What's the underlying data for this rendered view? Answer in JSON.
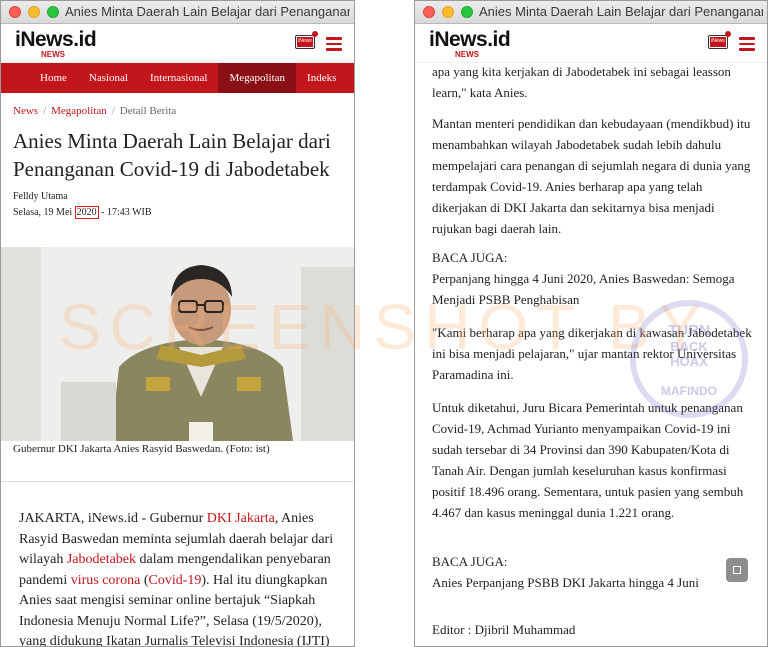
{
  "left": {
    "window_title": "Anies Minta Daerah Lain Belajar dari Penanganan Covid-19 di Jabodetabek",
    "logo_main": "iNews.id",
    "logo_sub": "NEWS",
    "tv_label": "iNews",
    "nav": [
      "Home",
      "Nasional",
      "Internasional",
      "Megapolitan",
      "Indeks"
    ],
    "breadcrumb": [
      "News",
      "Megapolitan",
      "Detail Berita"
    ],
    "headline": "Anies Minta Daerah Lain Belajar dari Penanganan Covid-19 di Jabodetabek",
    "author": "Felldy Utama",
    "date_prefix": "Selasa, 19 Mei ",
    "date_year": "2020",
    "date_suffix": " - 17:43 WIB",
    "caption": "Gubernur DKI Jakarta Anies Rasyid Baswedan. (Foto: ist)",
    "body": {
      "t1": "JAKARTA, iNews.id - Gubernur ",
      "l1": "DKI Jakarta",
      "t2": ", Anies Rasyid Baswedan meminta sejumlah daerah belajar dari wilayah ",
      "l2": "Jabodetabek",
      "t3": " dalam mengendalikan penyebaran pandemi ",
      "l3": "virus corona",
      "t4": " (",
      "l4": "Covid-19",
      "t5": "). Hal itu diungkapkan Anies saat mengisi seminar online bertajuk “Siapkah Indonesia Menuju Normal Life?”, Selasa (19/5/2020), yang didukung Ikatan Jurnalis Televisi Indonesia (IJTI)"
    }
  },
  "right": {
    "window_title": "Anies Minta Daerah Lain Belajar dari Penanganan Covid-19 di Jabodetabek",
    "logo_main": "iNews.id",
    "logo_sub": "NEWS",
    "tv_label": "iNews",
    "p1": "apa yang kita kerjakan di Jabodetabek ini sebagai leasson learn,\" kata Anies.",
    "p2": "Mantan menteri pendidikan dan kebudayaan (mendikbud) itu menambahkan wilayah Jabodetabek sudah lebih dahulu mempelajari cara penangan di sejumlah negara di dunia yang terdampak Covid-19. Anies berharap apa yang telah dikerjakan di DKI Jakarta dan sekitarnya bisa menjadi rujukan bagi daerah lain.",
    "baca1_label": "BACA JUGA:",
    "baca1_link": "Perpanjang hingga 4 Juni 2020, Anies Baswedan: Semoga Menjadi PSBB Penghabisan",
    "p3": "\"Kami berharap apa yang dikerjakan di kawasan Jabodetabek ini bisa menjadi pelajaran,\" ujar mantan rektor Universitas Paramadina ini.",
    "p4": "Untuk diketahui, Juru Bicara Pemerintah untuk penanganan Covid-19, Achmad Yurianto menyampaikan Covid-19 ini sudah tersebar di 34 Provinsi dan 390 Kabupaten/Kota di Tanah Air. Dengan jumlah keseluruhan kasus konfirmasi positif 18.496 orang. Sementara, untuk pasien yang sembuh 4.467 dan kasus meninggal dunia 1.221 orang.",
    "baca2_label": "BACA JUGA:",
    "baca2_link": "Anies Perpanjang PSBB DKI Jakarta hingga 4 Juni",
    "editor": "Editor : Djibril Muhammad"
  },
  "watermark": "SCREENSHOT BY",
  "stamp": {
    "top": "TURN",
    "mid1": "BACK",
    "mid2": "HOAX",
    "bottom": "MAFINDO"
  }
}
